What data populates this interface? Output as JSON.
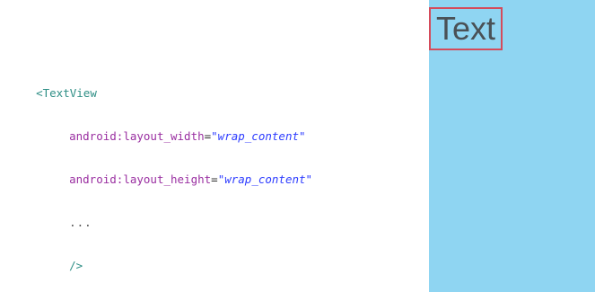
{
  "code": {
    "line1": "<TextView",
    "line2_attr": "android:layout_width",
    "line2_eq": "=",
    "line2_value": "\"wrap_content\"",
    "line3_attr": "android:layout_height",
    "line3_eq": "=",
    "line3_value": "\"wrap_content\"",
    "line4": "...",
    "line5": "/>"
  },
  "preview": {
    "text": "Text",
    "background_color": "#8fd5f2",
    "border_color": "#d54b5b"
  }
}
